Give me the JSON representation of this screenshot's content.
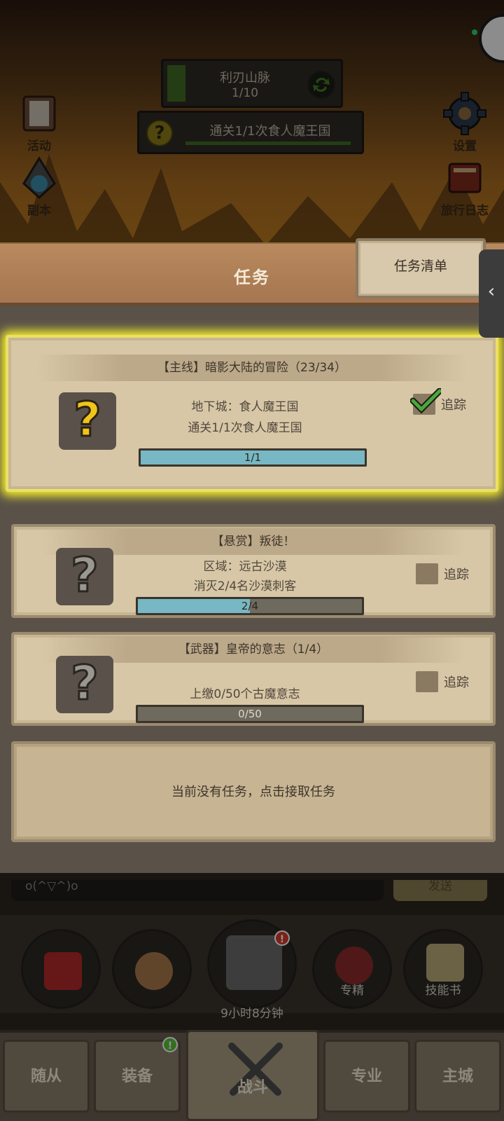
{
  "scene": {
    "stage_name": "利刃山脉",
    "stage_count": "1/10",
    "quest_tracker_text": "通关1/1次食人魔王国",
    "left_buttons": [
      {
        "label": "活动"
      },
      {
        "label": "副本"
      }
    ],
    "right_buttons": [
      {
        "label": "设置"
      },
      {
        "label": "旅行日志"
      }
    ]
  },
  "panel": {
    "title": "任务",
    "list_tab_label": "任务清单",
    "collapse_glyph": "‹"
  },
  "quests": [
    {
      "title": "【主线】暗影大陆的冒险（23/34）",
      "line1": "地下城：食人魔王国",
      "line2": "通关1/1次食人魔王国",
      "progress_text": "1/1",
      "progress": 1.0,
      "tracked": true,
      "track_label": "追踪",
      "icon": "question-gold-icon"
    },
    {
      "title": "【悬赏】叛徒！",
      "line1": "区域：远古沙漠",
      "line2": "消灭2/4名沙漠刺客",
      "progress_text": "2/4",
      "progress": 0.5,
      "tracked": false,
      "track_label": "追踪",
      "icon": "question-grey-icon"
    },
    {
      "title": "【武器】皇帝的意志（1/4）",
      "line1": "",
      "line2": "上缴0/50个古魔意志",
      "progress_text": "0/50",
      "progress": 0.0,
      "tracked": false,
      "track_label": "追踪",
      "icon": "question-grey-icon"
    }
  ],
  "empty_slot_text": "当前没有任务，点击接取任务",
  "chat": {
    "text": "o(^▽^)o",
    "send_label": "发送"
  },
  "skills": [
    {
      "label": ""
    },
    {
      "label": ""
    },
    {
      "label": ""
    },
    {
      "label": "专精"
    },
    {
      "label": "技能书"
    }
  ],
  "chest_timer": "9小时8分钟",
  "badges": {
    "chest": "!",
    "equip": "!"
  },
  "nav": [
    {
      "label": "随从"
    },
    {
      "label": "装备"
    },
    {
      "label": "战斗"
    },
    {
      "label": "专业"
    },
    {
      "label": "主城"
    }
  ]
}
